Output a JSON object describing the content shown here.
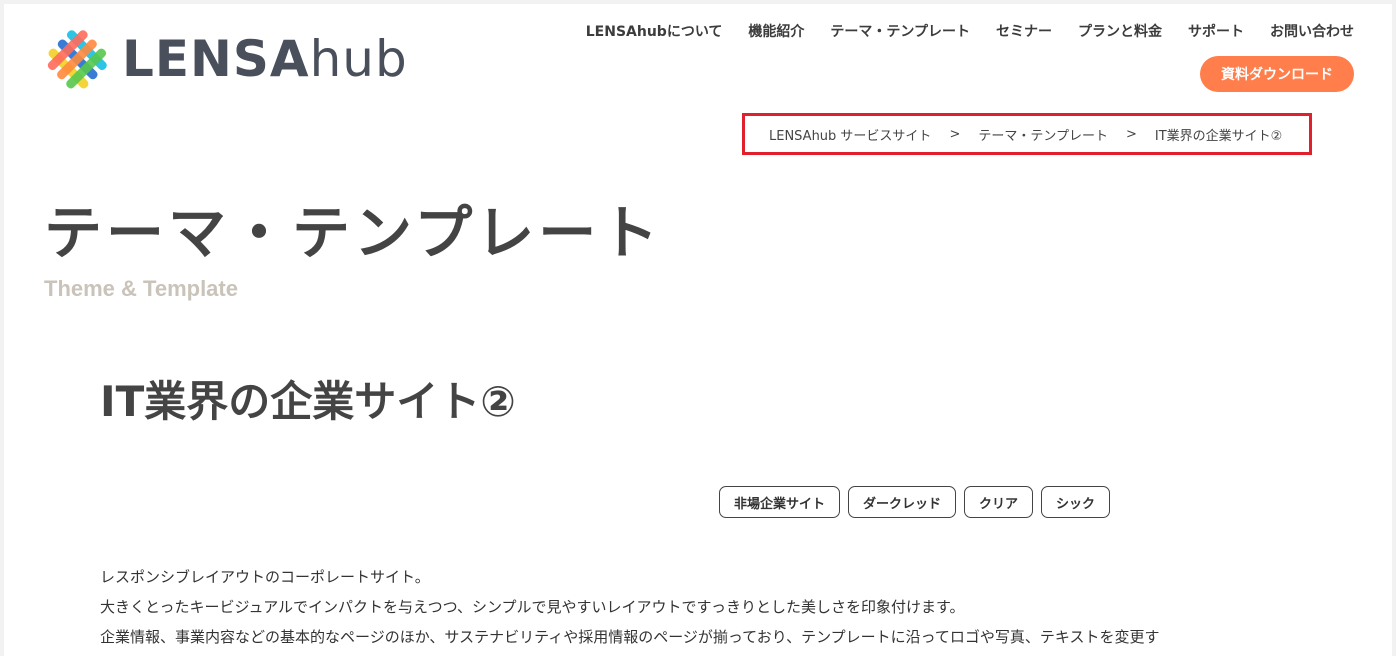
{
  "header": {
    "logo_text_strong": "LENSA",
    "logo_text_light": "hub",
    "nav": [
      "LENSAhubについて",
      "機能紹介",
      "テーマ・テンプレート",
      "セミナー",
      "プランと料金",
      "サポート",
      "お問い合わせ"
    ],
    "download_label": "資料ダウンロード"
  },
  "breadcrumb": {
    "items": [
      "LENSAhub サービスサイト",
      "テーマ・テンプレート",
      "IT業界の企業サイト②"
    ],
    "separator": ">"
  },
  "page": {
    "title": "テーマ・テンプレート",
    "subtitle": "Theme & Template"
  },
  "content": {
    "title": "IT業界の企業サイト②",
    "tags": [
      "非場企業サイト",
      "ダークレッド",
      "クリア",
      "シック"
    ],
    "description": [
      "レスポンシブレイアウトのコーポレートサイト。",
      "大きくとったキービジュアルでインパクトを与えつつ、シンプルで見やすいレイアウトですっきりとした美しさを印象付けます。",
      "企業情報、事業内容などの基本的なページのほか、サステナビリティや採用情報のページが揃っており、テンプレートに沿ってロゴや写真、テキストを変更す"
    ]
  },
  "colors": {
    "accent": "#ff7e4b",
    "highlight_border": "#e0202c",
    "subtitle": "#c9c3ba",
    "text": "#444444"
  },
  "icons": {
    "logo": "lensahub-woven-logo-icon"
  }
}
